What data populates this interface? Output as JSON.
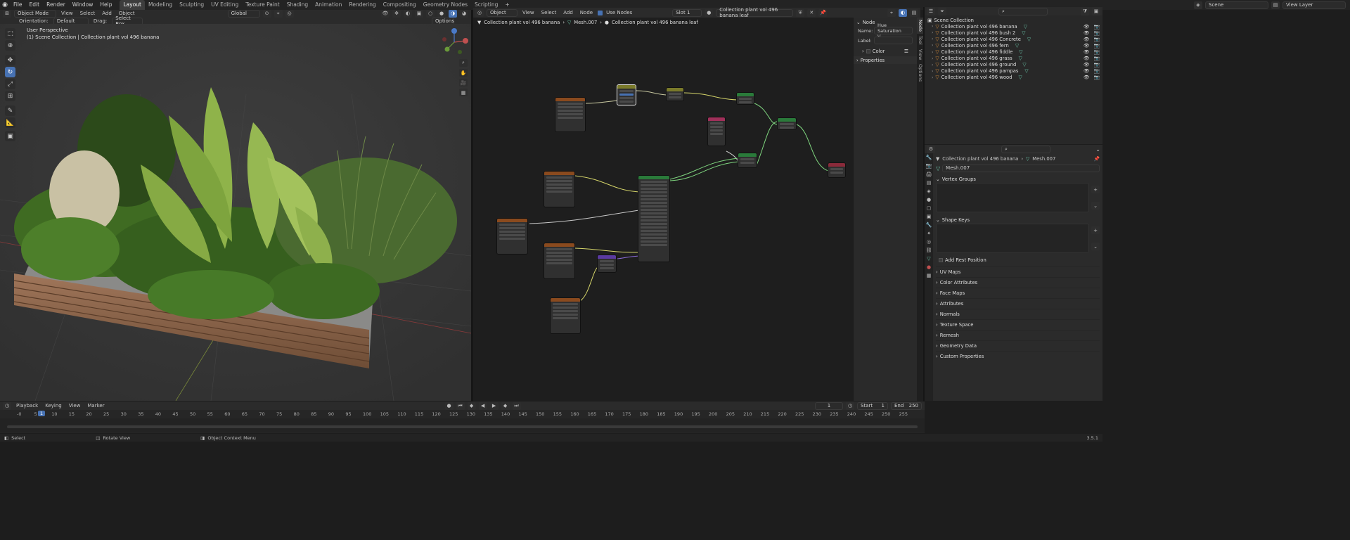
{
  "app": {
    "menus": [
      "File",
      "Edit",
      "Render",
      "Window",
      "Help"
    ],
    "workspaces": [
      "Layout",
      "Modeling",
      "Sculpting",
      "UV Editing",
      "Texture Paint",
      "Shading",
      "Animation",
      "Rendering",
      "Compositing",
      "Geometry Nodes",
      "Scripting"
    ],
    "add_workspace": "+",
    "scene": "Scene",
    "view_layer": "View Layer"
  },
  "viewport": {
    "mode": "Object Mode",
    "menus": [
      "View",
      "Select",
      "Add",
      "Object"
    ],
    "transform": "Global",
    "orientation_label": "Orientation:",
    "orientation": "Default",
    "drag_label": "Drag:",
    "drag": "Select Box",
    "options": "Options",
    "overlay_title": "User Perspective",
    "overlay_sub": "(1) Scene Collection | Collection plant vol 496 banana"
  },
  "node_editor": {
    "type": "Object",
    "menus": [
      "View",
      "Select",
      "Add",
      "Node"
    ],
    "use_nodes_label": "Use Nodes",
    "slot": "Slot 1",
    "material": "Collection plant vol 496 banana leaf",
    "breadcrumb": [
      "Collection plant vol 496 banana",
      "Mesh.007",
      "Collection plant vol 496 banana leaf"
    ]
  },
  "npanel": {
    "section": "Node",
    "name_label": "Name:",
    "name_value": "Hue Saturation V...",
    "label_label": "Label:",
    "color_label": "Color",
    "properties_label": "Properties",
    "tabs": [
      "Node",
      "Tool",
      "View",
      "Options"
    ]
  },
  "outliner": {
    "root": "Scene Collection",
    "items": [
      "Collection plant vol 496 banana",
      "Collection plant vol 496 bush 2",
      "Collection plant vol 496 Concrete",
      "Collection plant vol 496 fern",
      "Collection plant vol 496 fiddle",
      "Collection plant vol 496 grass",
      "Collection plant vol 496 ground",
      "Collection plant vol 496 pampas",
      "Collection plant vol 496 wood"
    ]
  },
  "properties": {
    "bread_object": "Collection plant vol 496 banana",
    "bread_mesh": "Mesh.007",
    "mesh_name": "Mesh.007",
    "vertex_groups": "Vertex Groups",
    "shape_keys": "Shape Keys",
    "add_rest_position": "Add Rest Position",
    "sections": [
      "UV Maps",
      "Color Attributes",
      "Face Maps",
      "Attributes",
      "Normals",
      "Texture Space",
      "Remesh",
      "Geometry Data",
      "Custom Properties"
    ]
  },
  "timeline": {
    "menus": [
      "Playback",
      "Keying",
      "View",
      "Marker"
    ],
    "current_frame": "1",
    "start_label": "Start",
    "start": "1",
    "end_label": "End",
    "end": "250",
    "ticks": [
      "-0",
      "5",
      "10",
      "15",
      "20",
      "25",
      "30",
      "35",
      "40",
      "45",
      "50",
      "55",
      "60",
      "65",
      "70",
      "75",
      "80",
      "85",
      "90",
      "95",
      "100",
      "105",
      "110",
      "115",
      "120",
      "125",
      "130",
      "135",
      "140",
      "145",
      "150",
      "155",
      "160",
      "165",
      "170",
      "175",
      "180",
      "185",
      "190",
      "195",
      "200",
      "205",
      "210",
      "215",
      "220",
      "225",
      "230",
      "235",
      "240",
      "245",
      "250",
      "255"
    ],
    "playhead": "1"
  },
  "statusbar": {
    "select": "Select",
    "rotate": "Rotate View",
    "context": "Object Context Menu",
    "version": "3.5.1"
  },
  "colors": {
    "accent": "#4772b3",
    "header": "#2b2b2b",
    "viewport_bg": "#393939",
    "node_bg": "#1e1e1e"
  }
}
